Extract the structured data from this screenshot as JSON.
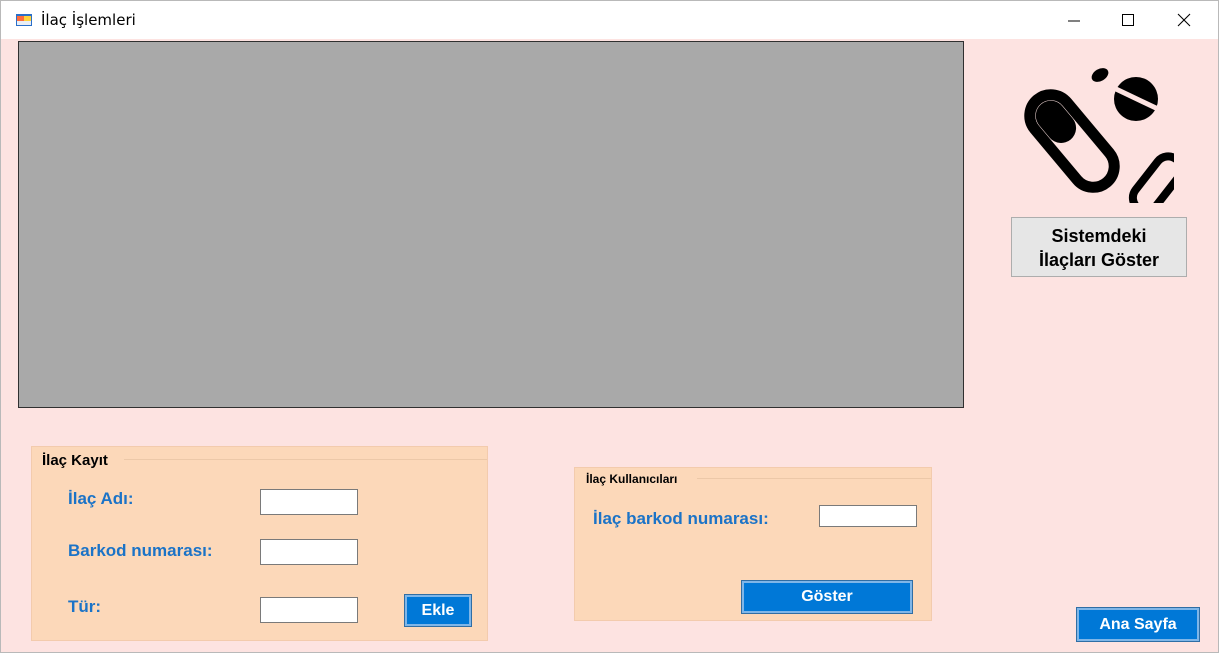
{
  "window": {
    "title": "İlaç İşlemleri",
    "icon": "app-form-icon",
    "controls": [
      "minimize-icon",
      "maximize-icon",
      "close-icon"
    ]
  },
  "grid": {
    "background": "#a9a9a9"
  },
  "show_drugs_button": {
    "line1": "Sistemdeki",
    "line2": "İlaçları Göster"
  },
  "kayit": {
    "title": "İlaç Kayıt",
    "name_label": "İlaç Adı:",
    "name_value": "",
    "barcode_label": "Barkod numarası:",
    "barcode_value": "",
    "type_label": "Tür:",
    "type_value": "",
    "add_label": "Ekle"
  },
  "kullanicilar": {
    "title": "İlaç Kullanıcıları",
    "barcode_label": "İlaç barkod numarası:",
    "barcode_value": "",
    "show_label": "Göster"
  },
  "home_button": "Ana Sayfa",
  "colors": {
    "background": "#fde3e1",
    "groupbox": "#fcd8b9",
    "label": "#1b73c7",
    "accent": "#0078d7"
  }
}
